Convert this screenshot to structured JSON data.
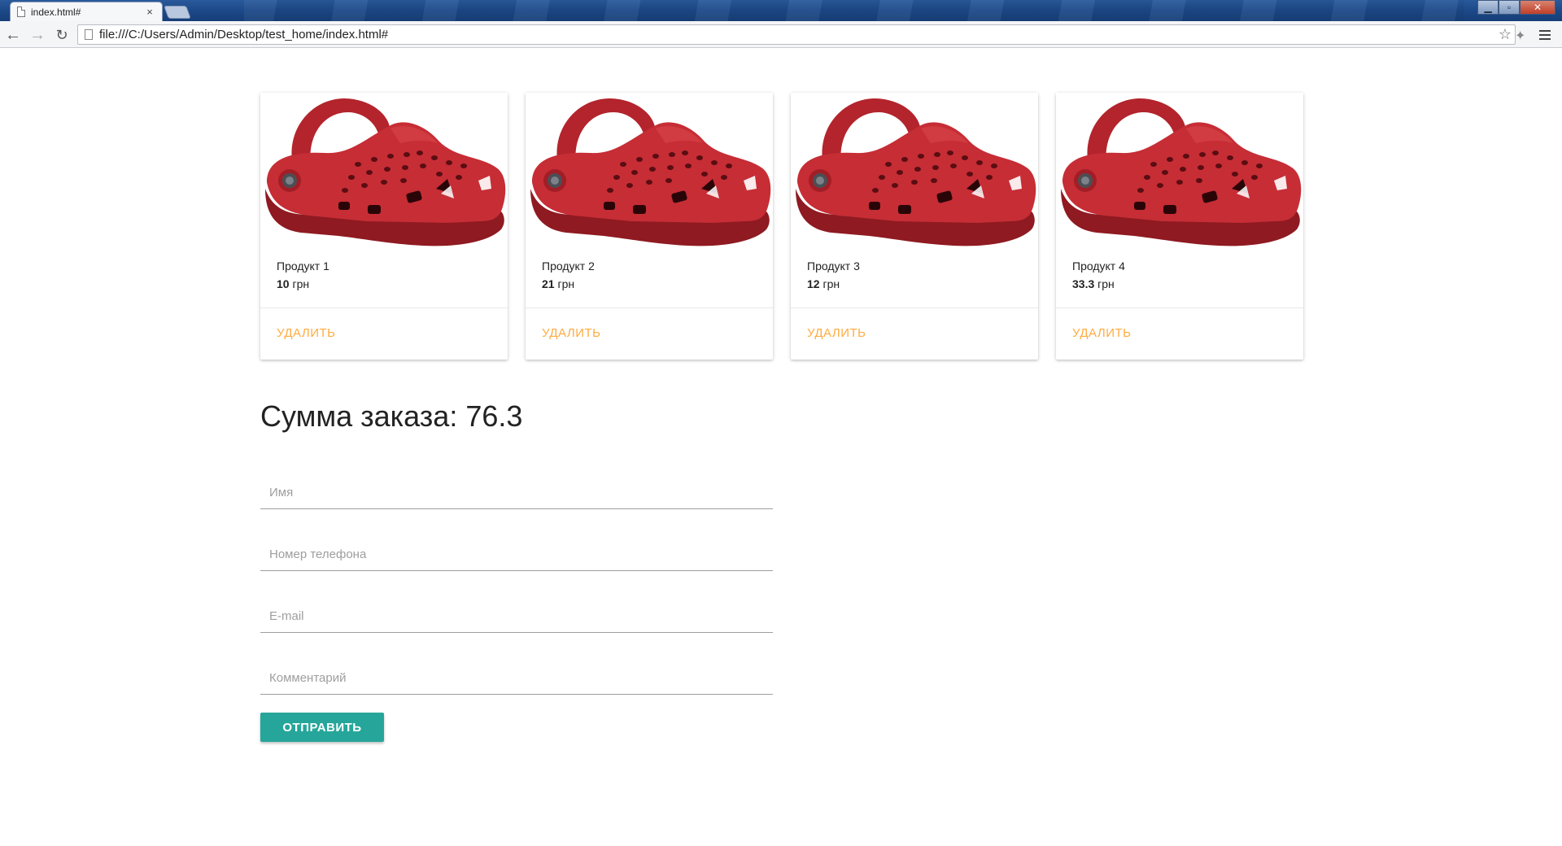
{
  "browser": {
    "tab_title": "index.html#",
    "tab_close": "×",
    "url": "file:///C:/Users/Admin/Desktop/test_home/index.html#",
    "back_icon": "←",
    "forward_icon": "→",
    "reload_icon": "↻",
    "star_icon": "☆",
    "extension_icon": "✦",
    "minimize": "▁",
    "maximize": "▫",
    "close": "✕"
  },
  "products": [
    {
      "name": "Продукт 1",
      "price": "10",
      "currency": "грн",
      "delete_label": "УДАЛИТЬ"
    },
    {
      "name": "Продукт 2",
      "price": "21",
      "currency": "грн",
      "delete_label": "УДАЛИТЬ"
    },
    {
      "name": "Продукт 3",
      "price": "12",
      "currency": "грн",
      "delete_label": "УДАЛИТЬ"
    },
    {
      "name": "Продукт 4",
      "price": "33.3",
      "currency": "грн",
      "delete_label": "УДАЛИТЬ"
    }
  ],
  "order": {
    "total_label": "Сумма заказа: 76.3"
  },
  "form": {
    "name_placeholder": "Имя",
    "phone_placeholder": "Номер телефона",
    "email_placeholder": "E-mail",
    "comment_placeholder": "Комментарий",
    "submit_label": "ОТПРАВИТЬ"
  },
  "colors": {
    "accent_teal": "#26a69a",
    "delete_orange": "#ffab40",
    "clog_red": "#c62d35"
  }
}
